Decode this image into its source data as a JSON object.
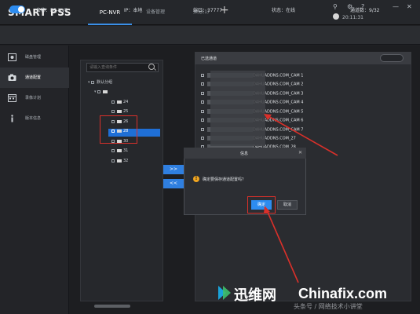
{
  "app": {
    "title": "SMART PSS",
    "tabs": [
      {
        "label": "PC-NVR"
      },
      {
        "label": "设备管理"
      },
      {
        "label": "预览(1)"
      }
    ],
    "add_tab": "+",
    "clock": "20:11:31",
    "window_controls": [
      "⚲",
      "⚙",
      "?",
      "—",
      "✕"
    ]
  },
  "info": {
    "name_label": "名称：PC-NVR",
    "ip_label": "IP：本地",
    "port_label": "端口：37777",
    "status_label": "状态：在线",
    "channels_label": "通道数：9/32"
  },
  "sidebar": {
    "items": [
      {
        "label": "磁盘管理",
        "icon": "disk-icon"
      },
      {
        "label": "通道配置",
        "icon": "camera-icon"
      },
      {
        "label": "录像计划",
        "icon": "calendar-icon"
      },
      {
        "label": "版本信息",
        "icon": "info-icon"
      }
    ]
  },
  "tree": {
    "search_placeholder": "请输入查询条件",
    "root": "默认分组",
    "device": "",
    "channels": [
      "24",
      "25",
      "26",
      "28",
      "30",
      "31",
      "32"
    ],
    "selected": "28"
  },
  "transfer": {
    "add": ">>",
    "remove": "<<"
  },
  "channels": {
    "title": "已选通道",
    "rows": [
      "DAHUADDNS.COM_CAM 1",
      "DAHUADDNS.COM_CAM 2",
      "DAHUADDNS.COM_CAM 3",
      "DAHUADDNS.COM_CAM 4",
      "DAHUADDNS.COM_CAM 5",
      "DAHUADDNS.COM_CAM 6",
      "DAHUADDNS.COM_CAM 7",
      "DAHUADDNS.COM_27",
      "DAHUADDNS.COM_28"
    ]
  },
  "dialog": {
    "title": "信息",
    "message": "确定要保存通道配置吗？",
    "ok": "确定",
    "cancel": "取消",
    "close": "✕"
  },
  "watermark": {
    "cn": "迅维网",
    "en": "Chinafix.com",
    "overlay": "头条号 / 网络技术小讲堂"
  },
  "colors": {
    "accent": "#2d8cf0",
    "highlight": "#d9302a",
    "warning": "#f0a520"
  }
}
